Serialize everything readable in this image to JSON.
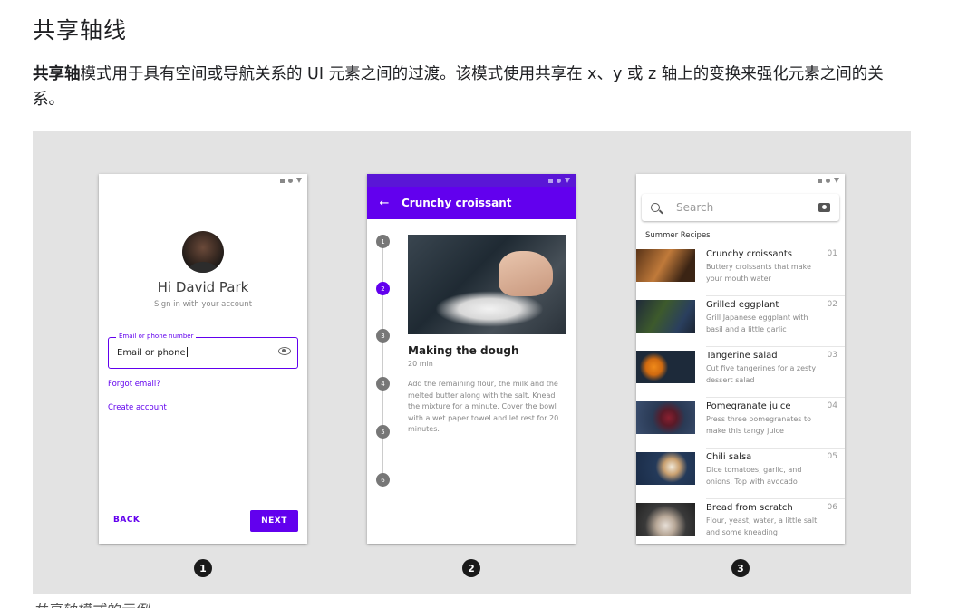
{
  "heading": "共享轴线",
  "paragraph": {
    "bold": "共享轴",
    "rest": "模式用于具有空间或导航关系的 UI 元素之间的过渡。该模式使用共享在 x、y 或 z 轴上的变换来强化元素之间的关系。"
  },
  "caption": "共享轴模式的示例",
  "phone1": {
    "greeting": "Hi David Park",
    "subtitle": "Sign in with your account",
    "field_label": "Email or phone number",
    "field_value": "Email or phone",
    "forgot": "Forgot email?",
    "create": "Create account",
    "back": "BACK",
    "next": "NEXT"
  },
  "phone2": {
    "title": "Crunchy croissant",
    "steps": [
      "1",
      "2",
      "3",
      "4",
      "5",
      "6"
    ],
    "active_step": "2",
    "section_title": "Making the dough",
    "duration": "20 min",
    "body": "Add the remaining flour, the milk and the melted butter along with the salt. Knead the mixture for a minute. Cover the bowl with a wet paper towel and let rest for 20 minutes."
  },
  "phone3": {
    "search_placeholder": "Search",
    "section": "Summer Recipes",
    "recipes": [
      {
        "title": "Crunchy croissants",
        "desc": "Buttery croissants that make your mouth water",
        "num": "01"
      },
      {
        "title": "Grilled eggplant",
        "desc": "Grill Japanese eggplant with basil and a little garlic",
        "num": "02"
      },
      {
        "title": "Tangerine salad",
        "desc": "Cut five tangerines for a zesty dessert salad",
        "num": "03"
      },
      {
        "title": "Pomegranate juice",
        "desc": "Press three pomegranates to make this tangy juice",
        "num": "04"
      },
      {
        "title": "Chili salsa",
        "desc": "Dice tomatoes, garlic, and onions. Top with avocado",
        "num": "05"
      },
      {
        "title": "Bread from scratch",
        "desc": "Flour, yeast, water, a little salt, and some kneading",
        "num": "06"
      }
    ]
  },
  "badges": [
    "1",
    "2",
    "3"
  ],
  "colors": {
    "accent": "#6200ee",
    "stage": "#e3e3e3"
  }
}
